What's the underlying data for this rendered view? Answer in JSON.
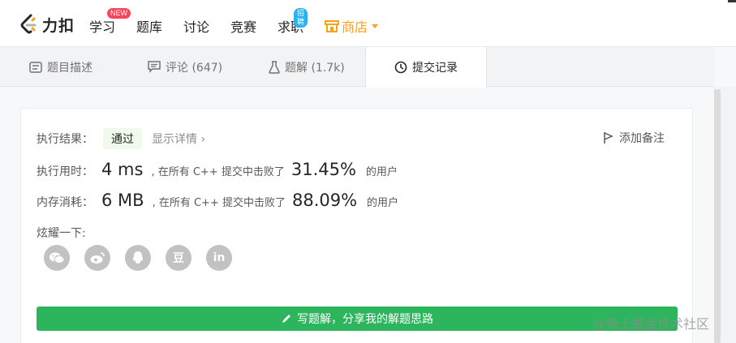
{
  "nav": {
    "brand": "力扣",
    "items": [
      {
        "label": "学习",
        "badge": "NEW"
      },
      {
        "label": "题库"
      },
      {
        "label": "讨论"
      },
      {
        "label": "竞赛"
      },
      {
        "label": "求职",
        "badge": "招聘"
      }
    ],
    "shop": "商店"
  },
  "tabs": [
    {
      "label": "题目描述",
      "icon": "description-icon"
    },
    {
      "label": "评论 (647)",
      "icon": "comment-icon"
    },
    {
      "label": "题解 (1.7k)",
      "icon": "flask-icon"
    },
    {
      "label": "提交记录",
      "icon": "clock-icon",
      "active": true
    }
  ],
  "result": {
    "label": "执行结果：",
    "status": "通过",
    "details": "显示详情 ›",
    "add_note": "添加备注",
    "time": {
      "label": "执行用时：",
      "value": "4 ms",
      "mid": ", 在所有 C++ 提交中击败了",
      "percent": "31.45%",
      "suffix": "的用户"
    },
    "memory": {
      "label": "内存消耗：",
      "value": "6 MB",
      "mid": ", 在所有 C++ 提交中击败了",
      "percent": "88.09%",
      "suffix": "的用户"
    },
    "share_label": "炫耀一下:",
    "share_icons": [
      "wechat-icon",
      "weibo-icon",
      "qq-icon",
      "douban-icon",
      "linkedin-icon"
    ],
    "share_glyphs": {
      "douban": "豆",
      "linkedin": "in"
    },
    "write_button": "写题解，分享我的解题思路"
  },
  "watermark": "@稀土掘金技术社区",
  "colors": {
    "accent": "#ffa116",
    "success": "#2db55d",
    "new_badge": "#f5475c",
    "job_badge": "#2db1f0"
  }
}
